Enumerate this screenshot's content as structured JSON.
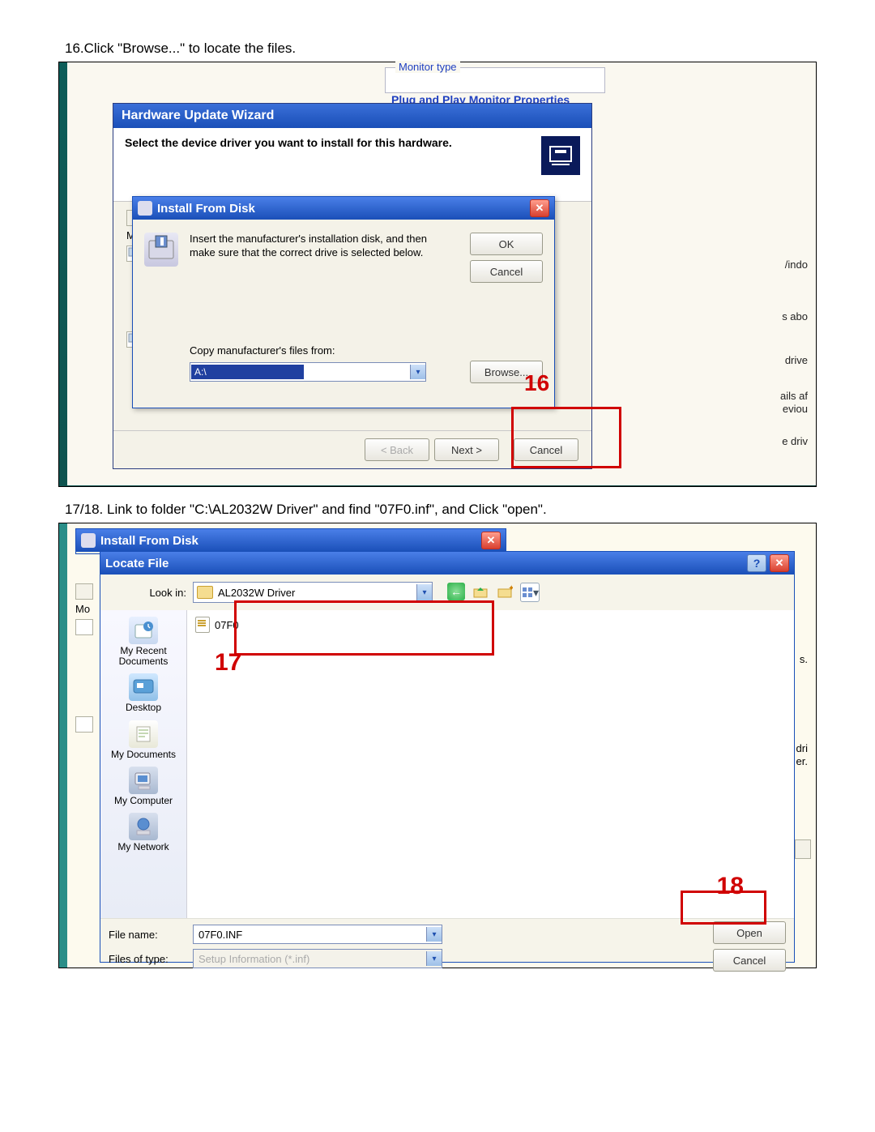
{
  "step16": {
    "instruction": "16.Click \"Browse...\" to locate the files.",
    "background_group_label": "Monitor type",
    "background_window_title": "Plug and Play Monitor Properties",
    "wizard_title": "Hardware Update Wizard",
    "wizard_heading": "Select the device driver you want to install for this hardware.",
    "back_button": "< Back",
    "next_button": "Next >",
    "cancel_button": "Cancel",
    "install_from_disk": {
      "title": "Install From Disk",
      "message": "Insert the manufacturer's installation disk, and then make sure that the correct drive is selected below.",
      "ok": "OK",
      "cancel": "Cancel",
      "copy_label": "Copy manufacturer's files from:",
      "path_value": "A:\\",
      "browse": "Browse..."
    },
    "callout": "16",
    "side_fragments": {
      "a": "/indo",
      "b": "s abo",
      "c": " drive",
      "d": "ails af",
      "e": "eviou",
      "f": "e driv"
    }
  },
  "step1718": {
    "instruction": "17/18. Link to folder \"C:\\AL2032W Driver\" and find \"07F0.inf\", and Click \"open\".",
    "ifd_title": "Install From Disk",
    "locate_title": "Locate File",
    "lookin_label": "Look in:",
    "lookin_value": "AL2032W Driver",
    "file_item": "07F0",
    "callout17": "17",
    "callout18": "18",
    "places": {
      "recent": "My Recent Documents",
      "desktop": "Desktop",
      "mydocs": "My Documents",
      "mycomp": "My Computer",
      "mynet": "My Network"
    },
    "filename_label": "File name:",
    "filename_value": "07F0.INF",
    "filetype_label": "Files of type:",
    "filetype_value": "Setup Information (*.inf)",
    "open_button": "Open",
    "cancel_button": "Cancel",
    "side_fragments": {
      "a": "dri",
      "b": "er.",
      "c": "s."
    }
  }
}
